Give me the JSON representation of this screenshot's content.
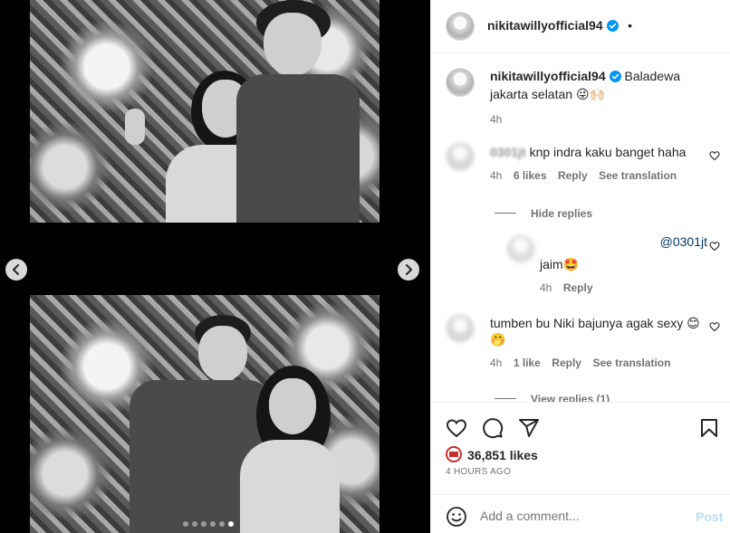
{
  "post": {
    "author": "nikitawillyofficial94",
    "more_label": "•",
    "caption": "Baladewa jakarta selatan 😜🙌🏻",
    "caption_time": "4h"
  },
  "media": {
    "prev_label": "Previous",
    "next_label": "Next",
    "slide_count": 6,
    "active_slide": 6
  },
  "comments": [
    {
      "user": "0301jt",
      "text": "knp indra kaku banget haha",
      "time": "4h",
      "likes": "6 likes",
      "reply": "Reply",
      "translate": "See translation",
      "hide_replies": "Hide replies"
    },
    {
      "user": "",
      "mention": "@0301jt",
      "text": "jaim🤩",
      "time": "4h",
      "reply": "Reply"
    },
    {
      "user": "",
      "text": "tumben bu Niki bajunya agak sexy 😊🤭",
      "time": "4h",
      "likes": "1 like",
      "reply": "Reply",
      "translate": "See translation",
      "view_replies": "View replies (1)"
    }
  ],
  "actions": {
    "likes": "36,851 likes",
    "timestamp": "4 HOURS AGO"
  },
  "composer": {
    "placeholder": "Add a comment...",
    "post_label": "Post"
  },
  "colors": {
    "verified": "#0095f6",
    "post_button_disabled": "#b2dffc",
    "link": "#00376b"
  }
}
